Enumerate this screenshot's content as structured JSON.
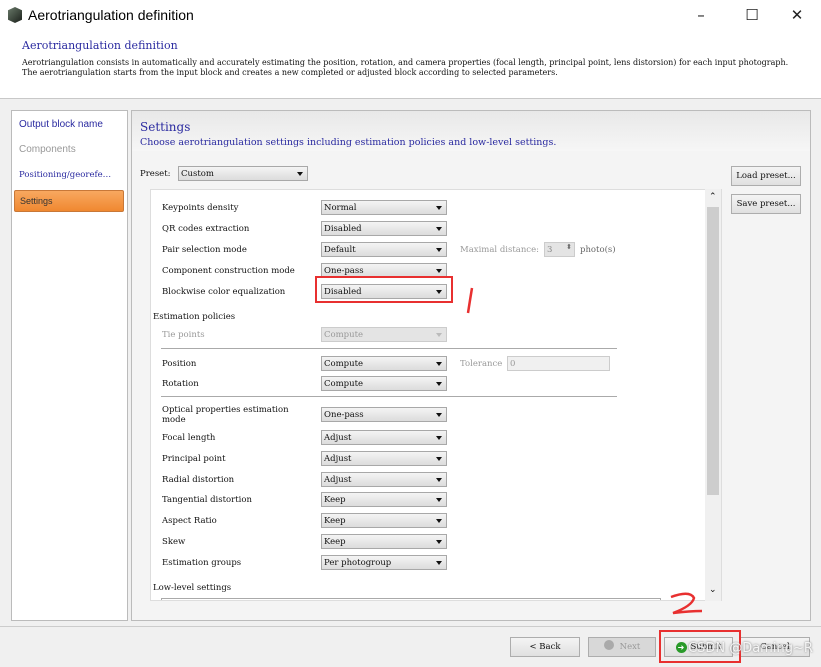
{
  "window": {
    "title": "Aerotriangulation definition",
    "minimize": "–",
    "maximize": "☐",
    "close": "✕"
  },
  "header": {
    "title": "Aerotriangulation definition",
    "description": "Aerotriangulation consists in automatically and accurately estimating the position, rotation, and camera properties (focal length, principal point, lens distorsion) for each input photograph.",
    "description2": "The aerotriangulation starts from the input block and creates a new completed or adjusted block according to selected parameters."
  },
  "sidebar": {
    "items": [
      {
        "label": "Output block name"
      },
      {
        "label": "Components"
      },
      {
        "label": "Positioning/georefe…"
      },
      {
        "label": "Settings"
      }
    ]
  },
  "settings": {
    "title": "Settings",
    "subtitle": "Choose aerotriangulation settings including estimation policies and low-level settings.",
    "preset_label": "Preset:",
    "preset_value": "Custom",
    "load_preset": "Load preset...",
    "save_preset": "Save preset..."
  },
  "rows": {
    "keypoints": {
      "label": "Keypoints density",
      "value": "Normal"
    },
    "qr": {
      "label": "QR codes extraction",
      "value": "Disabled"
    },
    "pair": {
      "label": "Pair selection mode",
      "value": "Default",
      "extra_label": "Maximal distance:",
      "extra_value": "3",
      "extra_unit": "photo(s)"
    },
    "component": {
      "label": "Component construction mode",
      "value": "One-pass"
    },
    "blockwise": {
      "label": "Blockwise color equalization",
      "value": "Disabled"
    },
    "estimation_heading": "Estimation policies",
    "tie": {
      "label": "Tie points",
      "value": "Compute"
    },
    "position": {
      "label": "Position",
      "value": "Compute",
      "extra_label": "Tolerance",
      "extra_value": "0"
    },
    "rotation": {
      "label": "Rotation",
      "value": "Compute"
    },
    "optical": {
      "label": "Optical properties estimation mode",
      "value": "One-pass"
    },
    "focal": {
      "label": "Focal length",
      "value": "Adjust"
    },
    "principal": {
      "label": "Principal point",
      "value": "Adjust"
    },
    "radial": {
      "label": "Radial distortion",
      "value": "Adjust"
    },
    "tangential": {
      "label": "Tangential distortion",
      "value": "Keep"
    },
    "aspect": {
      "label": "Aspect Ratio",
      "value": "Keep"
    },
    "skew": {
      "label": "Skew",
      "value": "Keep"
    },
    "groups": {
      "label": "Estimation groups",
      "value": "Per photogroup"
    },
    "lowlevel_heading": "Low-level settings"
  },
  "footer": {
    "back": "< Back",
    "next": "Next",
    "submit": "Submit",
    "cancel": "Cancel"
  },
  "annotations": {
    "mark1": "1",
    "mark2": "2",
    "color": "#e83030"
  },
  "watermark": "CSDN @Daming~R"
}
